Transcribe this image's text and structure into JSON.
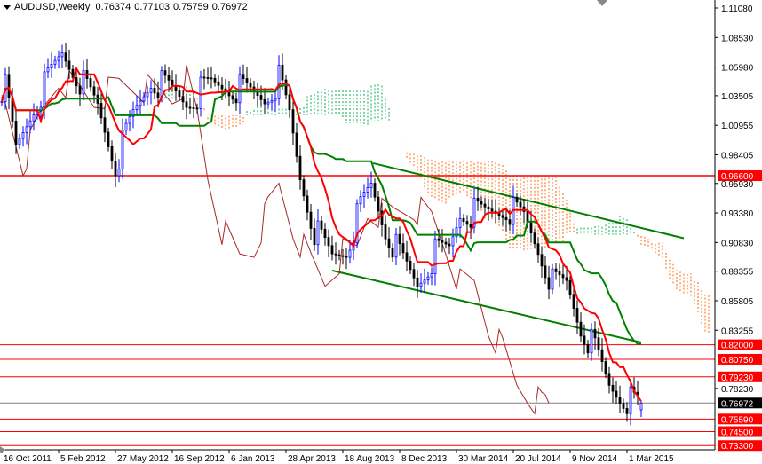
{
  "header": {
    "symbol": "AUDUSD,Weekly",
    "open": "0.76374",
    "high": "0.77103",
    "low": "0.75759",
    "close": "0.76972"
  },
  "colors": {
    "up": "#0000ff",
    "down": "#000000",
    "tenkan": "#ff0000",
    "kijun": "#008000",
    "chikou": "#a52a2a",
    "cloud_bear": "#ff6600",
    "cloud_bull": "#00aa55",
    "level": "#ff0000",
    "current": "#808080",
    "channel": "#008000"
  },
  "chart_data": {
    "type": "candlestick",
    "title": "AUDUSD,Weekly",
    "ylim": [
      0.733,
      1.123
    ],
    "y_ticks": [
      "1.11080",
      "1.08530",
      "1.05980",
      "1.03505",
      "1.00955",
      "0.98405",
      "0.95930",
      "0.93380",
      "0.90830",
      "0.88355",
      "0.85805",
      "0.83255",
      "0.78230"
    ],
    "x_ticks": [
      {
        "week": 0,
        "label": "16 Oct 2011"
      },
      {
        "week": 16,
        "label": "5 Feb 2012"
      },
      {
        "week": 32,
        "label": "27 May 2012"
      },
      {
        "week": 48,
        "label": "16 Sep 2012"
      },
      {
        "week": 64,
        "label": "6 Jan 2013"
      },
      {
        "week": 80,
        "label": "28 Apr 2013"
      },
      {
        "week": 96,
        "label": "18 Aug 2013"
      },
      {
        "week": 112,
        "label": "8 Dec 2013"
      },
      {
        "week": 128,
        "label": "30 Mar 2014"
      },
      {
        "week": 144,
        "label": "20 Jul 2014"
      },
      {
        "week": 160,
        "label": "9 Nov 2014"
      },
      {
        "week": 176,
        "label": "1 Mar 2015"
      }
    ],
    "close_samples": [
      [
        0,
        1.03
      ],
      [
        1,
        1.041
      ],
      [
        4,
        0.988
      ],
      [
        9,
        1.026
      ],
      [
        17,
        1.072
      ],
      [
        22,
        1.049
      ],
      [
        27,
        1.026
      ],
      [
        32,
        0.976
      ],
      [
        37,
        1.018
      ],
      [
        42,
        1.049
      ],
      [
        47,
        1.041
      ],
      [
        52,
        1.03
      ],
      [
        59,
        1.045
      ],
      [
        67,
        1.041
      ],
      [
        74,
        1.033
      ],
      [
        78,
        1.049
      ],
      [
        81,
        1.018
      ],
      [
        84,
        0.965
      ],
      [
        88,
        0.919
      ],
      [
        93,
        0.896
      ],
      [
        97,
        0.903
      ],
      [
        101,
        0.938
      ],
      [
        104,
        0.957
      ],
      [
        108,
        0.919
      ],
      [
        113,
        0.892
      ],
      [
        117,
        0.873
      ],
      [
        122,
        0.899
      ],
      [
        126,
        0.903
      ],
      [
        129,
        0.934
      ],
      [
        136,
        0.934
      ],
      [
        142,
        0.938
      ],
      [
        147,
        0.93
      ],
      [
        151,
        0.903
      ],
      [
        155,
        0.873
      ],
      [
        159,
        0.873
      ],
      [
        163,
        0.835
      ],
      [
        167,
        0.816
      ],
      [
        171,
        0.785
      ],
      [
        174,
        0.777
      ],
      [
        178,
        0.769
      ],
      [
        180,
        0.7697
      ]
    ],
    "levels": [
      {
        "value": 0.966,
        "label": "0.96600",
        "full": true
      },
      {
        "value": 0.82,
        "label": "0.82000"
      },
      {
        "value": 0.8075,
        "label": "0.80750"
      },
      {
        "value": 0.7923,
        "label": "0.79230"
      },
      {
        "value": 0.7559,
        "label": "0.75590"
      },
      {
        "value": 0.745,
        "label": "0.74500"
      },
      {
        "value": 0.733,
        "label": "0.73300"
      }
    ],
    "current_price": {
      "value": 0.76972,
      "label": "0.76972"
    },
    "channel": [
      {
        "from": [
          104.5,
          0.9768
        ],
        "to": [
          192,
          0.912
        ]
      },
      {
        "from": [
          93,
          0.8841
        ],
        "to": [
          180,
          0.822
        ]
      }
    ],
    "ichimoku": {
      "tenkan": 9,
      "kijun": 26,
      "senkou_b": 52,
      "shift": 26
    }
  }
}
